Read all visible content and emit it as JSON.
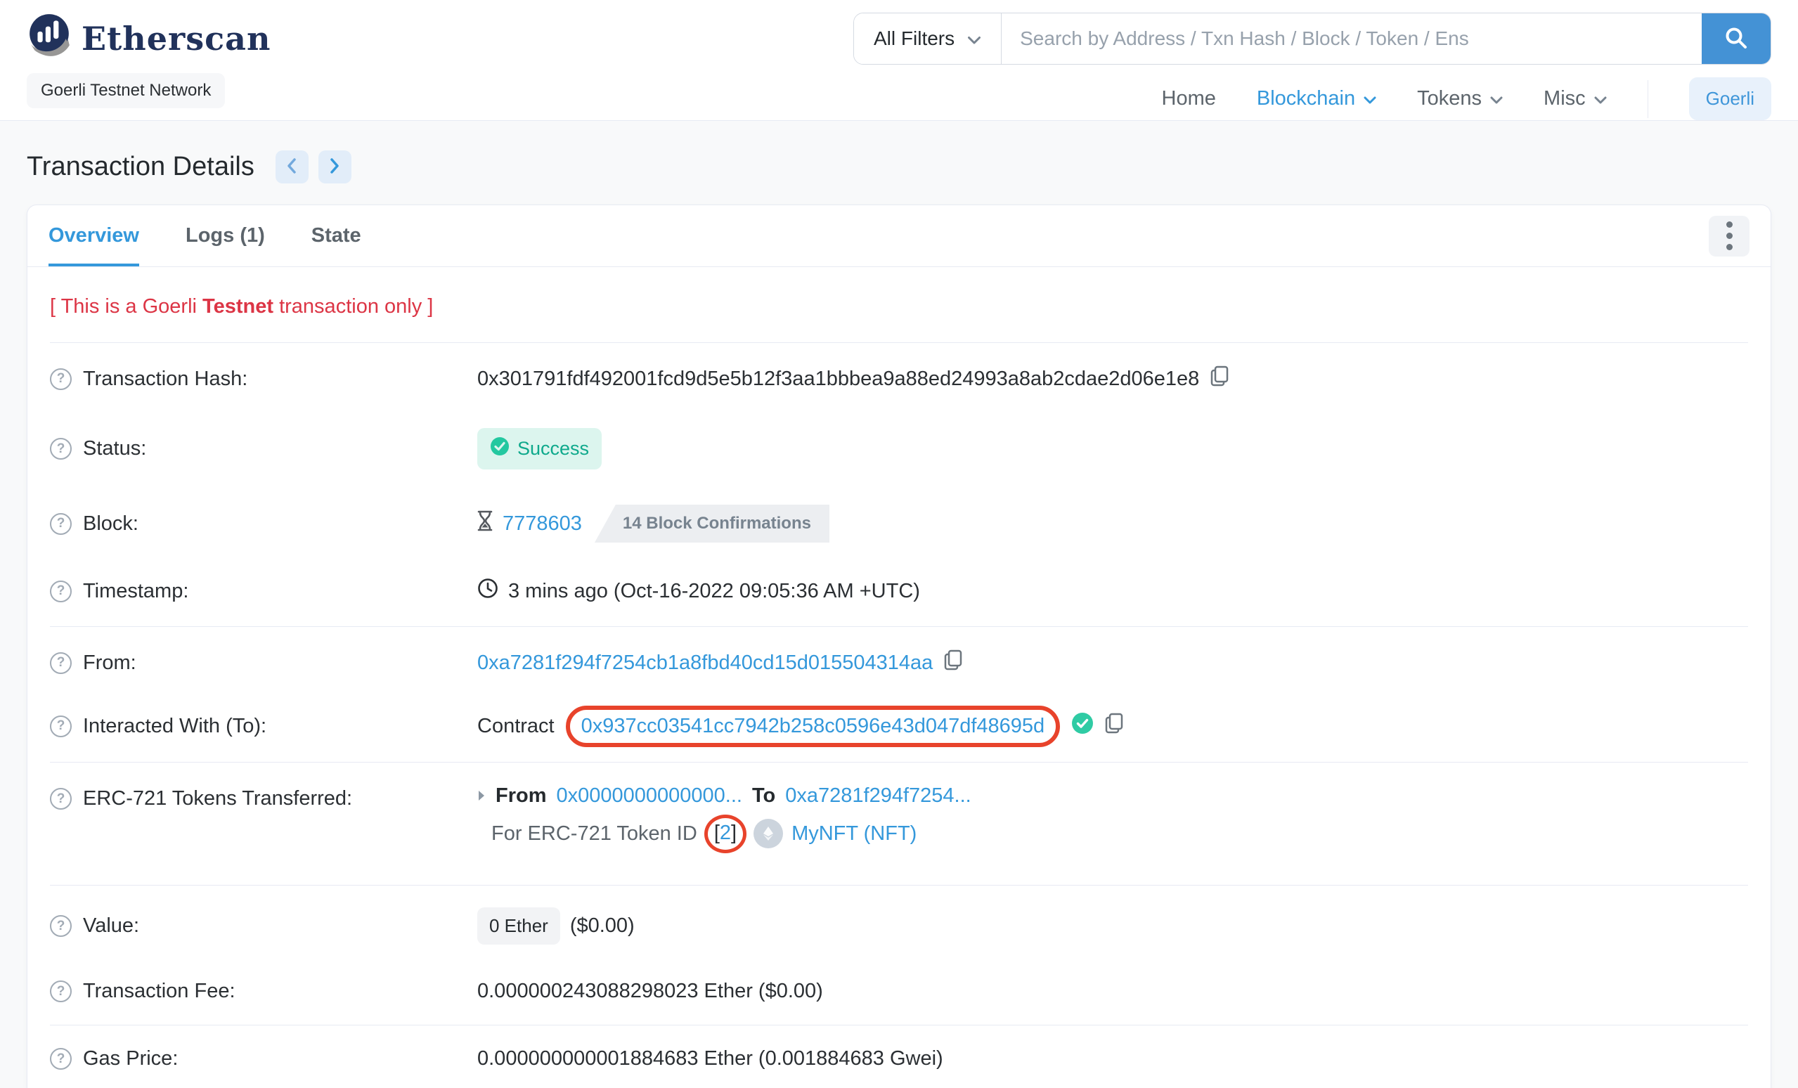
{
  "header": {
    "brand": "Etherscan",
    "network_badge": "Goerli Testnet Network",
    "search": {
      "filter_label": "All Filters",
      "placeholder": "Search by Address / Txn Hash / Block / Token / Ens"
    },
    "nav": {
      "home": "Home",
      "blockchain": "Blockchain",
      "tokens": "Tokens",
      "misc": "Misc",
      "network_button": "Goerli"
    }
  },
  "page": {
    "title": "Transaction Details"
  },
  "tabs": {
    "overview": "Overview",
    "logs": "Logs (1)",
    "state": "State"
  },
  "warning": {
    "prefix": "[ This is a Goerli ",
    "bold": "Testnet",
    "suffix": " transaction only ]"
  },
  "rows": {
    "hash": {
      "label": "Transaction Hash:",
      "value": "0x301791fdf492001fcd9d5e5b12f3aa1bbbea9a88ed24993a8ab2cdae2d06e1e8"
    },
    "status": {
      "label": "Status:",
      "value": "Success"
    },
    "block": {
      "label": "Block:",
      "number": "7778603",
      "confirmations": "14 Block Confirmations"
    },
    "timestamp": {
      "label": "Timestamp:",
      "value": "3 mins ago (Oct-16-2022 09:05:36 AM +UTC)"
    },
    "from": {
      "label": "From:",
      "address": "0xa7281f294f7254cb1a8fbd40cd15d015504314aa"
    },
    "to": {
      "label": "Interacted With (To):",
      "prefix": "Contract",
      "address": "0x937cc03541cc7942b258c0596e43d047df48695d"
    },
    "erc721": {
      "label": "ERC-721 Tokens Transferred:",
      "from_label": "From",
      "from_address": "0x0000000000000...",
      "to_label": "To",
      "to_address": "0xa7281f294f7254...",
      "for_label": "For ERC-721 Token ID",
      "bracket_open": "[",
      "token_id": "2",
      "bracket_close": "]",
      "token_name": "MyNFT (NFT)"
    },
    "value": {
      "label": "Value:",
      "badge": "0 Ether",
      "usd": "($0.00)"
    },
    "fee": {
      "label": "Transaction Fee:",
      "value": "0.000000243088298023 Ether ($0.00)"
    },
    "gasprice": {
      "label": "Gas Price:",
      "value": "0.000000000001884683 Ether (0.001884683 Gwei)"
    }
  },
  "colors": {
    "accent_blue": "#3498db",
    "brand_navy": "#21325b",
    "success_green": "#0fa98c",
    "warning_red": "#dc3545",
    "annotation_red": "#e8432b",
    "badge_gray": "#eceef1"
  }
}
